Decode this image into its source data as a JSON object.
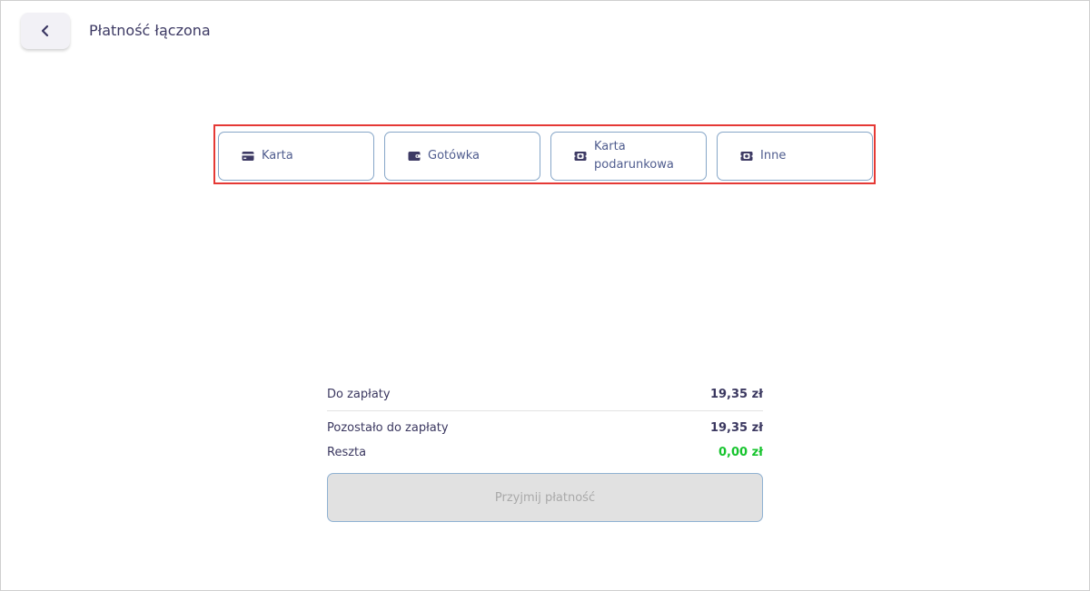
{
  "header": {
    "title": "Płatność łączona",
    "back_icon": "chevron-left-icon"
  },
  "payment_methods": [
    {
      "label": "Karta",
      "icon": "credit-card-icon"
    },
    {
      "label": "Gotówka",
      "icon": "wallet-icon"
    },
    {
      "label": "Karta podarunkowa",
      "icon": "gift-card-icon"
    },
    {
      "label": "Inne",
      "icon": "other-payment-icon"
    }
  ],
  "summary": {
    "to_pay_label": "Do zapłaty",
    "to_pay_value": "19,35 zł",
    "remaining_label": "Pozostało do zapłaty",
    "remaining_value": "19,35 zł",
    "change_label": "Reszta",
    "change_value": "0,00 zł"
  },
  "accept_button": {
    "label": "Przyjmij płatność"
  },
  "colors": {
    "accent": "#3d3a64",
    "highlight_border": "#e53935",
    "change_green": "#17c42e",
    "disabled_bg": "#e1e1e1"
  }
}
